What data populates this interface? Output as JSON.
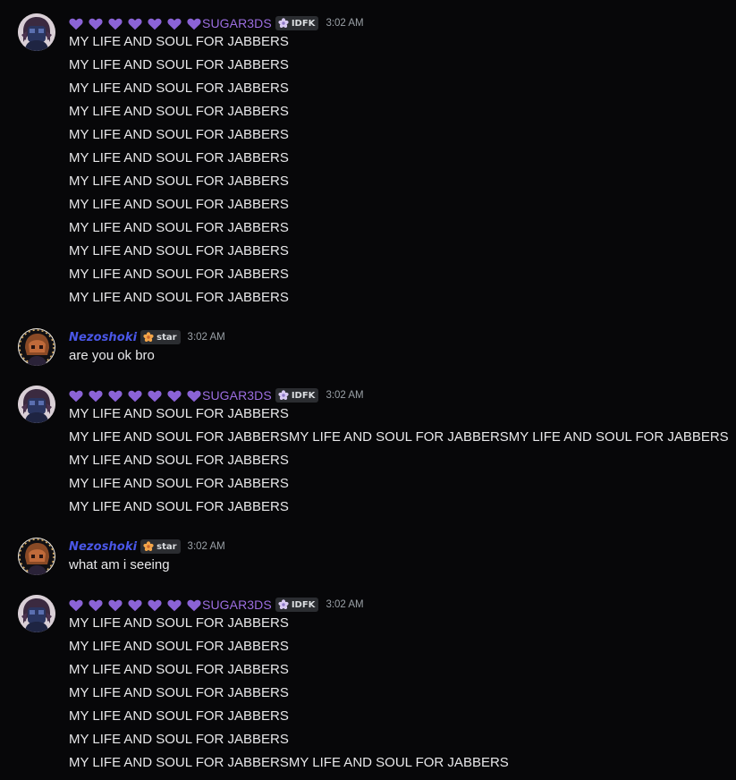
{
  "colors": {
    "background": "#070709",
    "sugar_name": "#9c6ee0",
    "nezo_name": "#4a57e8",
    "heart": "#8b63d6",
    "tag_bg": "#2b2d31",
    "timestamp": "#9aa0a6",
    "text": "#e8e8ea"
  },
  "messages": [
    {
      "author": "SUGAR3DS",
      "hearts": 7,
      "tag_icon": "flower-icon",
      "tag": "IDFK",
      "time": "3:02 AM",
      "lines": [
        "MY LIFE AND SOUL FOR JABBERS",
        "MY LIFE AND SOUL FOR JABBERS",
        "MY LIFE AND SOUL FOR JABBERS",
        "MY LIFE AND SOUL FOR JABBERS",
        "MY LIFE AND SOUL FOR JABBERS",
        "MY LIFE AND SOUL FOR JABBERS",
        "MY LIFE AND SOUL FOR JABBERS",
        "MY LIFE AND SOUL FOR JABBERS",
        "MY LIFE AND SOUL FOR JABBERS",
        "MY LIFE AND SOUL FOR JABBERS",
        "MY LIFE AND SOUL FOR JABBERS",
        "MY LIFE AND SOUL FOR JABBERS"
      ]
    },
    {
      "author": "Nezoshoki",
      "tag_icon": "orange-flower-icon",
      "tag": "star",
      "time": "3:02 AM",
      "lines": [
        "are you ok bro"
      ]
    },
    {
      "author": "SUGAR3DS",
      "hearts": 7,
      "tag_icon": "flower-icon",
      "tag": "IDFK",
      "time": "3:02 AM",
      "lines": [
        "MY LIFE AND SOUL FOR JABBERS",
        "MY LIFE AND SOUL FOR JABBERSMY LIFE AND SOUL FOR JABBERSMY LIFE AND SOUL FOR JABBERS",
        "MY LIFE AND SOUL FOR JABBERS",
        "MY LIFE AND SOUL FOR JABBERS",
        "MY LIFE AND SOUL FOR JABBERS"
      ]
    },
    {
      "author": "Nezoshoki",
      "tag_icon": "orange-flower-icon",
      "tag": "star",
      "time": "3:02 AM",
      "lines": [
        "what am i seeing"
      ]
    },
    {
      "author": "SUGAR3DS",
      "hearts": 7,
      "tag_icon": "flower-icon",
      "tag": "IDFK",
      "time": "3:02 AM",
      "lines": [
        "MY LIFE AND SOUL FOR JABBERS",
        "MY LIFE AND SOUL FOR JABBERS",
        "MY LIFE AND SOUL FOR JABBERS",
        "MY LIFE AND SOUL FOR JABBERS",
        "MY LIFE AND SOUL FOR JABBERS",
        "MY LIFE AND SOUL FOR JABBERS",
        "MY LIFE AND SOUL FOR JABBERSMY LIFE AND SOUL FOR JABBERS"
      ]
    }
  ]
}
